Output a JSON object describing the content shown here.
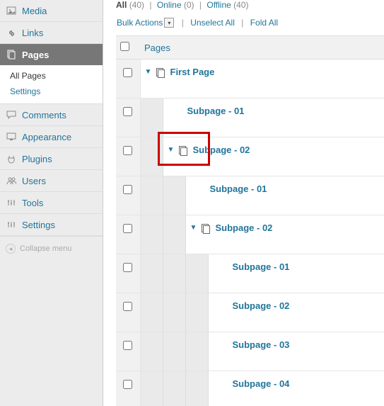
{
  "sidebar": {
    "items": [
      {
        "label": "Media",
        "icon": "media-icon"
      },
      {
        "label": "Links",
        "icon": "links-icon"
      },
      {
        "label": "Pages",
        "icon": "pages-icon",
        "current": true,
        "sub": [
          {
            "label": "All Pages",
            "current": true
          },
          {
            "label": "Settings"
          }
        ]
      },
      {
        "label": "Comments",
        "icon": "comments-icon"
      },
      {
        "label": "Appearance",
        "icon": "appearance-icon"
      },
      {
        "label": "Plugins",
        "icon": "plugins-icon"
      },
      {
        "label": "Users",
        "icon": "users-icon"
      },
      {
        "label": "Tools",
        "icon": "tools-icon"
      },
      {
        "label": "Settings",
        "icon": "settings-icon"
      }
    ],
    "collapse_label": "Collapse menu"
  },
  "filters": {
    "all_label": "All",
    "all_count": "(40)",
    "online_label": "Online",
    "online_count": "(0)",
    "offline_label": "Offline",
    "offline_count": "(40)"
  },
  "bulk": {
    "bulk_label": "Bulk Actions",
    "unselect_label": "Unselect All",
    "fold_label": "Fold All"
  },
  "table": {
    "header_title": "Pages",
    "rows": [
      {
        "indent": 0,
        "toggle": true,
        "title": "First Page"
      },
      {
        "indent": 1,
        "toggle": false,
        "title": "Subpage - 01"
      },
      {
        "indent": 1,
        "toggle": true,
        "title": "Subpage - 02"
      },
      {
        "indent": 2,
        "toggle": false,
        "title": "Subpage - 01"
      },
      {
        "indent": 2,
        "toggle": true,
        "title": "Subpage - 02"
      },
      {
        "indent": 3,
        "toggle": false,
        "title": "Subpage - 01"
      },
      {
        "indent": 3,
        "toggle": false,
        "title": "Subpage - 02"
      },
      {
        "indent": 3,
        "toggle": false,
        "title": "Subpage - 03"
      },
      {
        "indent": 3,
        "toggle": false,
        "title": "Subpage - 04"
      }
    ]
  }
}
